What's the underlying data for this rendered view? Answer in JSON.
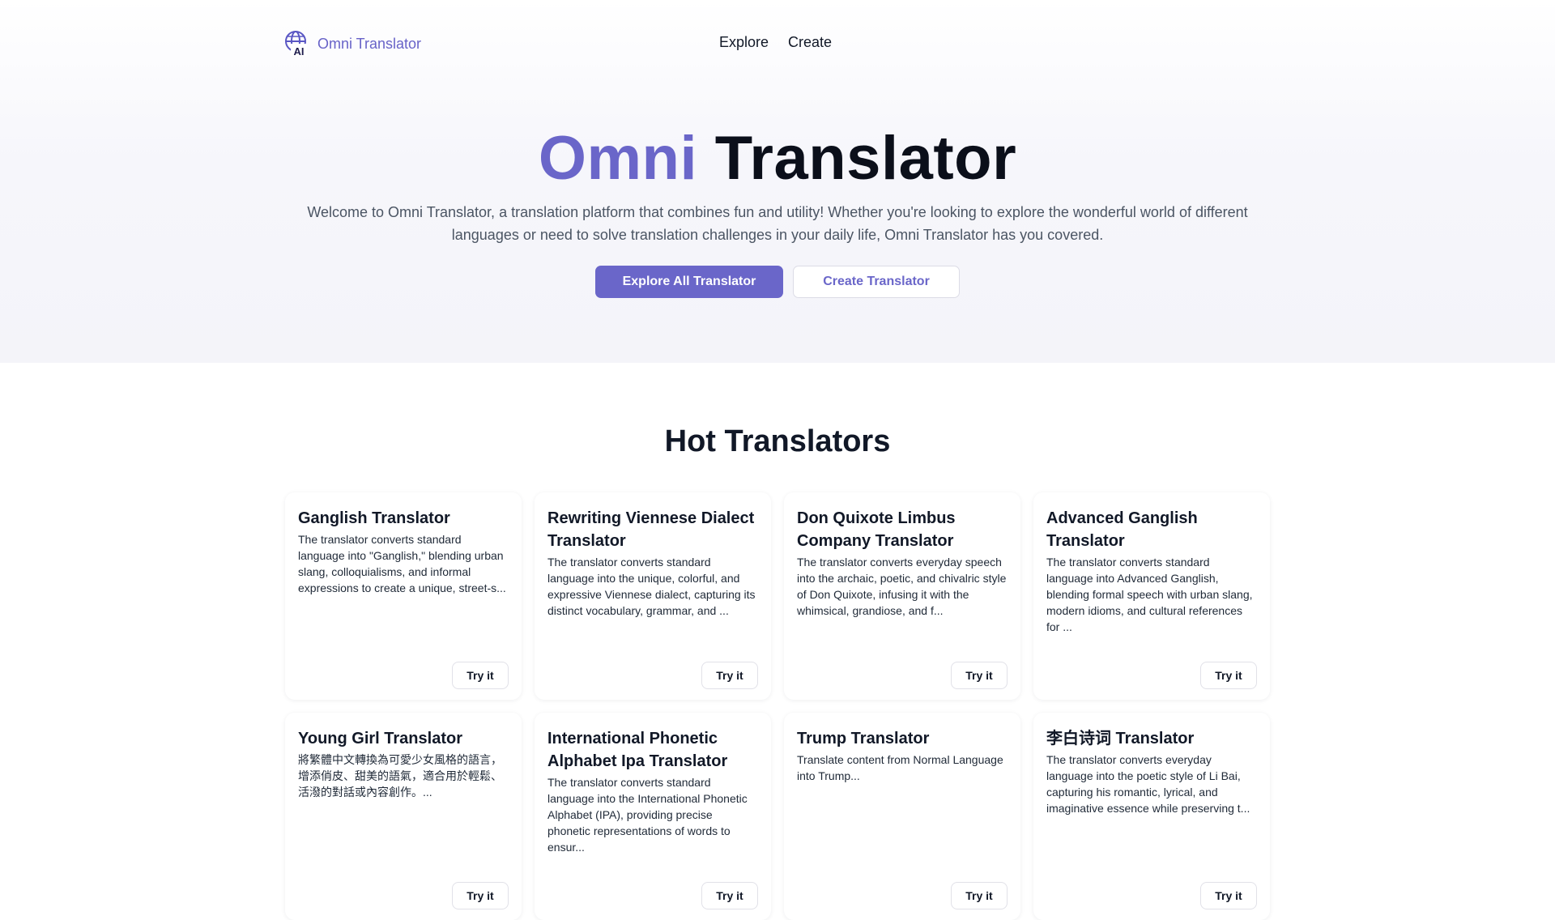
{
  "nav": {
    "brand": "Omni Translator",
    "links": [
      "Explore",
      "Create"
    ]
  },
  "hero": {
    "title_accent": "Omni",
    "title_rest": "Translator",
    "description": "Welcome to Omni Translator, a translation platform that combines fun and utility! Whether you're looking to explore the wonderful world of different languages or need to solve translation challenges in your daily life, Omni Translator has you covered.",
    "primary_button": "Explore All Translator",
    "secondary_button": "Create Translator"
  },
  "hot": {
    "title": "Hot Translators",
    "try_label": "Try it",
    "cards": [
      {
        "title": "Ganglish Translator",
        "description": "The translator converts standard language into \"Ganglish,\" blending urban slang, colloquialisms, and informal expressions to create a unique, street-s..."
      },
      {
        "title": "Rewriting Viennese Dialect Translator",
        "description": "The translator converts standard language into the unique, colorful, and expressive Viennese dialect, capturing its distinct vocabulary, grammar, and ..."
      },
      {
        "title": "Don Quixote Limbus Company Translator",
        "description": "The translator converts everyday speech into the archaic, poetic, and chivalric style of Don Quixote, infusing it with the whimsical, grandiose, and f..."
      },
      {
        "title": "Advanced Ganglish Translator",
        "description": "The translator converts standard language into Advanced Ganglish, blending formal speech with urban slang, modern idioms, and cultural references for ..."
      },
      {
        "title": "Young Girl Translator",
        "description": "將繁體中文轉換為可愛少女風格的語言，增添俏皮、甜美的語氣，適合用於輕鬆、活潑的對話或內容創作。..."
      },
      {
        "title": "International Phonetic Alphabet Ipa Translator",
        "description": "The translator converts standard language into the International Phonetic Alphabet (IPA), providing precise phonetic representations of words to ensur..."
      },
      {
        "title": "Trump Translator",
        "description": "Translate content from Normal Language into Trump..."
      },
      {
        "title": "李白诗词 Translator",
        "description": "The translator converts everyday language into the poetic style of Li Bai, capturing his romantic, lyrical, and imaginative essence while preserving t..."
      }
    ]
  },
  "colors": {
    "accent": "#6a66c9",
    "heading": "#0b0f1a",
    "body_text": "#4b5563"
  },
  "icons": {
    "brand_logo": "globe-ai-icon"
  }
}
